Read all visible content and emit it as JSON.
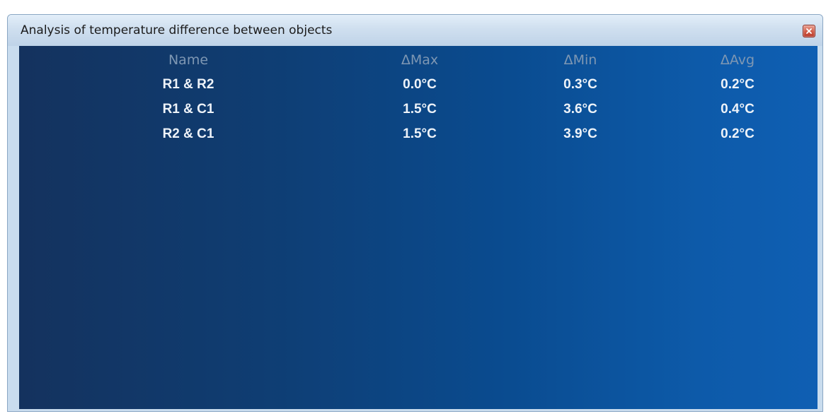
{
  "window": {
    "title": "Analysis of temperature difference between objects"
  },
  "table": {
    "headers": [
      "Name",
      "ΔMax",
      "ΔMin",
      "ΔAvg"
    ],
    "rows": [
      [
        "R1 & R2",
        "0.0°C",
        "0.3°C",
        "0.2°C"
      ],
      [
        "R1 & C1",
        "1.5°C",
        "3.6°C",
        "0.4°C"
      ],
      [
        "R2 & C1",
        "1.5°C",
        "3.9°C",
        "0.2°C"
      ]
    ]
  },
  "icons": {
    "close": "close-icon"
  },
  "colors": {
    "panel_left": "#14325e",
    "panel_right": "#0f5fb3",
    "header_text": "#7e97b3",
    "cell_text": "#eef3f9",
    "close_button": "#d05c48"
  }
}
